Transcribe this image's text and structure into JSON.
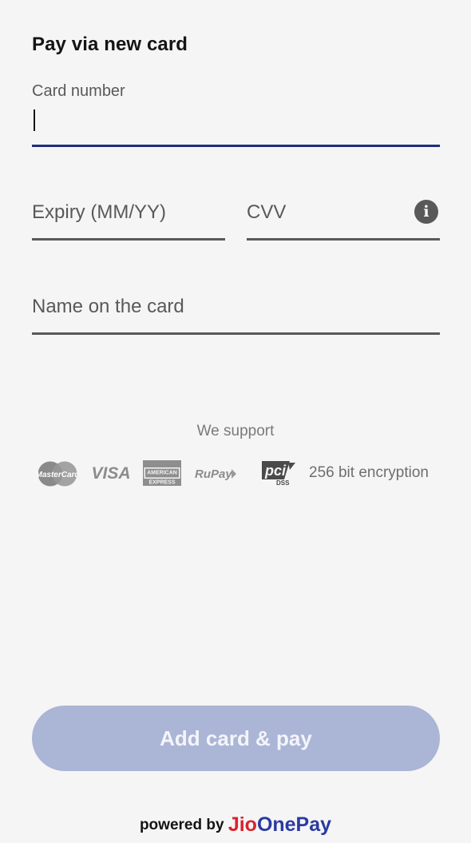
{
  "form": {
    "title": "Pay via new card",
    "card_number": {
      "label": "Card number",
      "value": ""
    },
    "expiry": {
      "placeholder": "Expiry (MM/YY)"
    },
    "cvv": {
      "placeholder": "CVV",
      "info_icon": "info-icon"
    },
    "name": {
      "placeholder": "Name on the card"
    }
  },
  "support": {
    "heading": "We support",
    "logos": [
      {
        "name": "MasterCard",
        "icon": "mastercard-logo"
      },
      {
        "name": "VISA",
        "icon": "visa-logo"
      },
      {
        "name": "AMERICAN EXPRESS",
        "icon": "amex-logo"
      },
      {
        "name": "RuPay",
        "icon": "rupay-logo"
      },
      {
        "name": "PCI DSS",
        "icon": "pci-dss-logo"
      }
    ],
    "encryption": "256 bit encryption"
  },
  "cta": {
    "label": "Add card & pay",
    "color": "#abb5d6"
  },
  "footer": {
    "prefix": "powered by",
    "brand_jio": "Jio",
    "brand_onepay": "OnePay"
  },
  "colors": {
    "accent_underline": "#1f2f7a",
    "brand_red": "#d9232e",
    "brand_blue": "#2b3aa0"
  }
}
